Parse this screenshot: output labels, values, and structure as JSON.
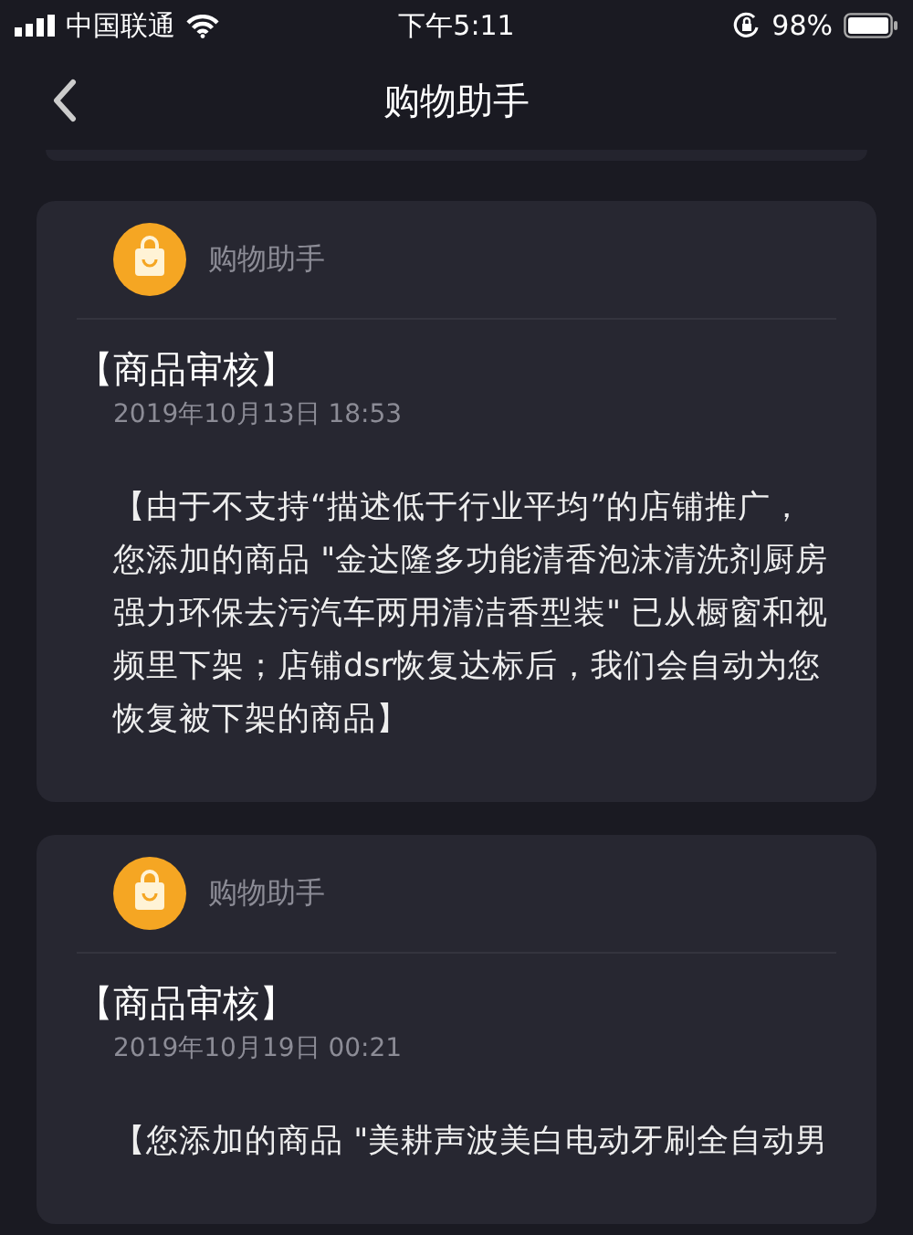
{
  "status_bar": {
    "carrier": "中国联通",
    "time": "下午5:11",
    "battery": "98%"
  },
  "nav": {
    "title": "购物助手"
  },
  "messages": [
    {
      "sender": "购物助手",
      "title": "【商品审核】",
      "date": "2019年10月13日 18:53",
      "body": "【由于不支持“描述低于行业平均”的店铺推广，您添加的商品 \"金达隆多功能清香泡沫清洗剂厨房强力环保去污汽车两用清洁香型装\" 已从橱窗和视频里下架；店铺dsr恢复达标后，我们会自动为您恢复被下架的商品】"
    },
    {
      "sender": "购物助手",
      "title": "【商品审核】",
      "date": "2019年10月19日 00:21",
      "body": "【您添加的商品 \"美耕声波美白电动牙刷全自动男"
    }
  ]
}
